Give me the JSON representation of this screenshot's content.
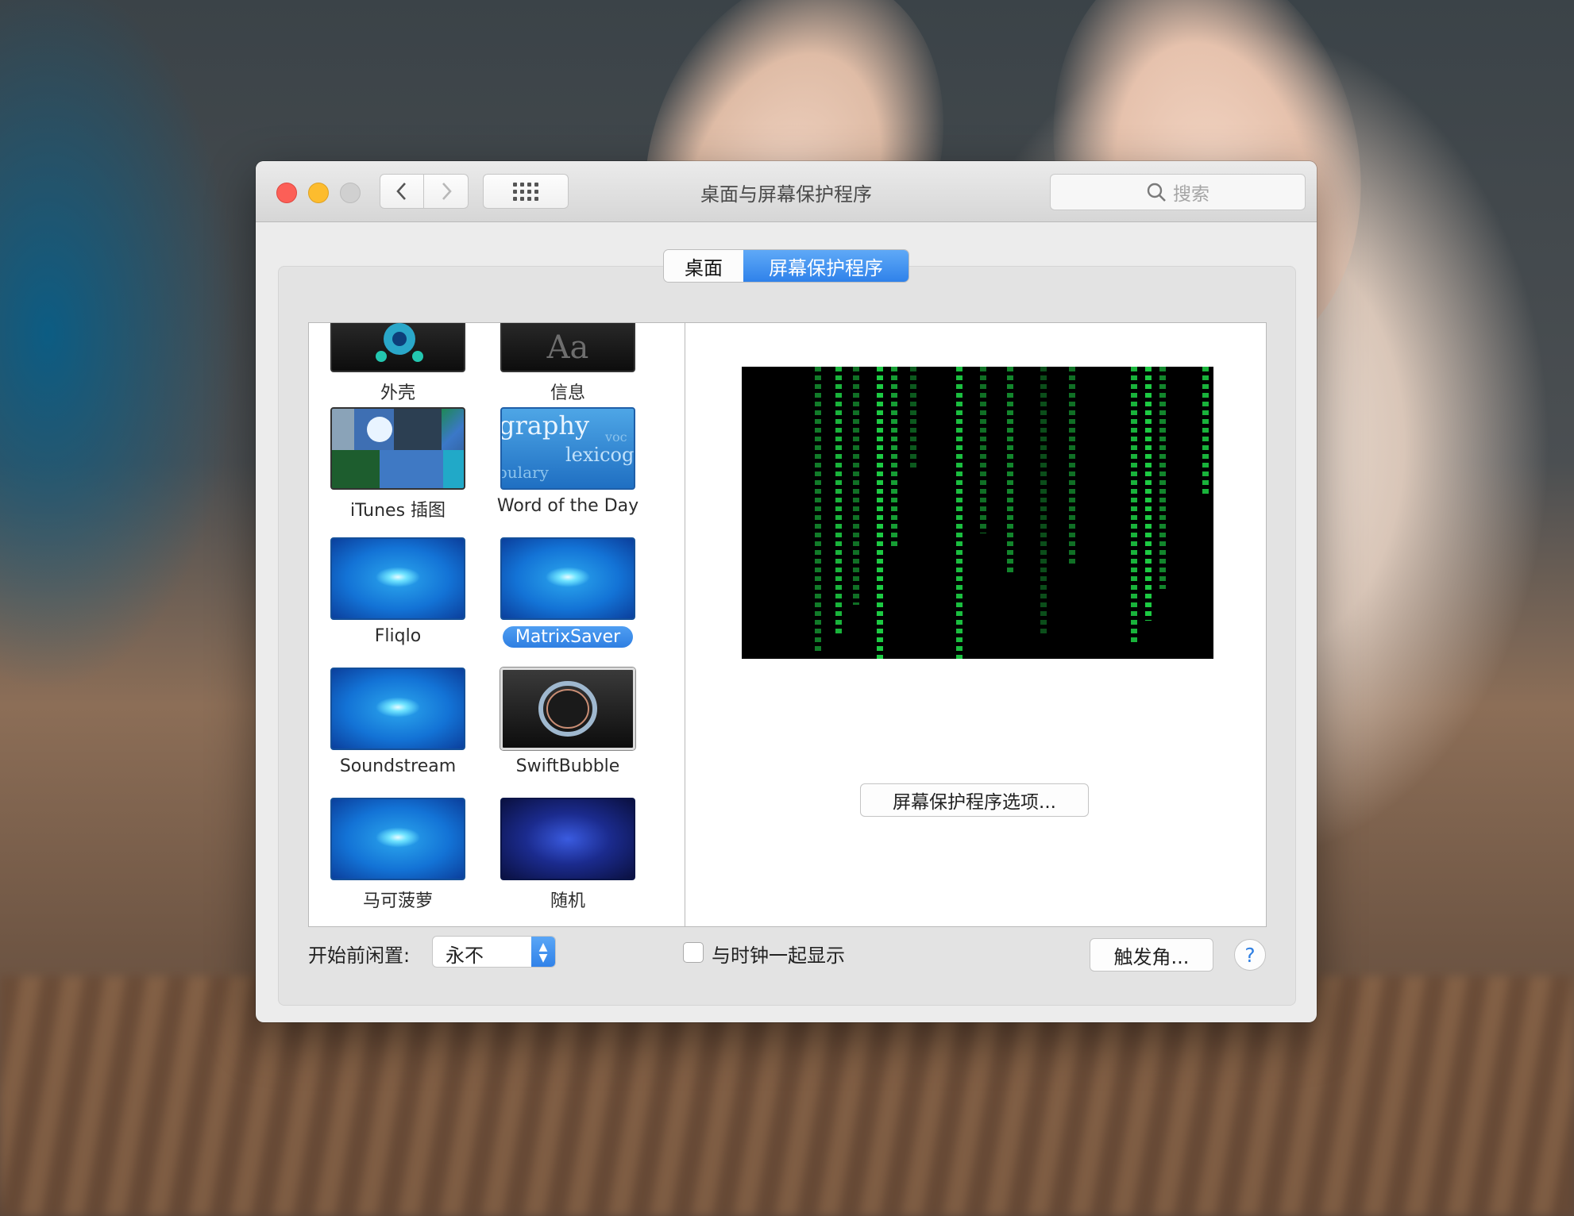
{
  "window": {
    "title": "桌面与屏幕保护程序"
  },
  "toolbar": {
    "back_icon": "chevron-left-icon",
    "forward_icon": "chevron-right-icon",
    "show_all_icon": "grid-icon"
  },
  "search": {
    "placeholder": "搜索",
    "icon": "search-icon"
  },
  "tabs": [
    {
      "label": "桌面",
      "selected": false
    },
    {
      "label": "屏幕保护程序",
      "selected": true
    }
  ],
  "screensavers": [
    {
      "label": "外壳",
      "selected": false
    },
    {
      "label": "信息",
      "selected": false
    },
    {
      "label": "iTunes 插图",
      "selected": false
    },
    {
      "label": "Word of the Day",
      "selected": false
    },
    {
      "label": "Fliqlo",
      "selected": false
    },
    {
      "label": "MatrixSaver",
      "selected": true
    },
    {
      "label": "Soundstream",
      "selected": false
    },
    {
      "label": "SwiftBubble",
      "selected": false
    },
    {
      "label": "马可菠萝",
      "selected": false
    },
    {
      "label": "随机",
      "selected": false
    }
  ],
  "thumb_text": {
    "info": "Aa",
    "word_1": "graphy",
    "word_2": "lexicog",
    "word_3": "bulary",
    "word_4": "voc"
  },
  "preview": {
    "options_label": "屏幕保护程序选项..."
  },
  "bottom": {
    "idle_label": "开始前闲置:",
    "idle_value": "永不",
    "clock_label": "与时钟一起显示",
    "clock_checked": false,
    "hot_corners_label": "触发角...",
    "help_label": "?"
  },
  "colors": {
    "accent": "#2f82ea",
    "matrix_green": "#1fe04a"
  }
}
